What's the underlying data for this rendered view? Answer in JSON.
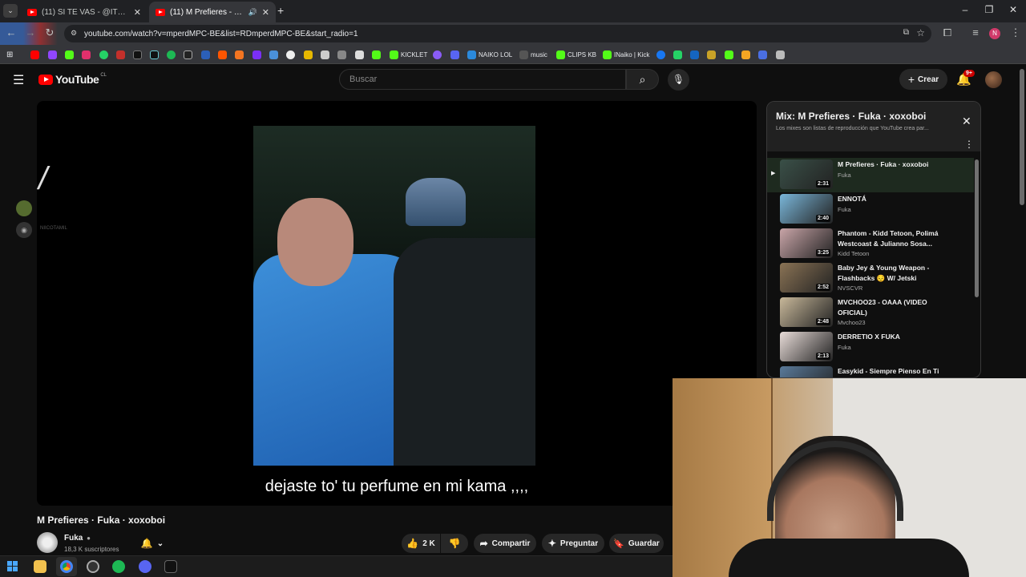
{
  "browser": {
    "tabs": [
      {
        "label": "(11) SI TE VAS - @ITHANNY | VI",
        "active": false
      },
      {
        "label": "(11) M Prefieres - Fuka - xox",
        "active": true
      }
    ],
    "url": "youtube.com/watch?v=mperdMPC-BE&list=RDmperdMPC-BE&start_radio=1",
    "bookmarks": [
      "KICKLET",
      "NAIKO LOL",
      "music",
      "CLIPS KB",
      "INaiko | Kick"
    ]
  },
  "youtube": {
    "logo": "YouTube",
    "region": "CL",
    "search_placeholder": "Buscar",
    "create_label": "Crear",
    "notifications": "9+",
    "avatar_letter": "N"
  },
  "video": {
    "subtitle": "dejaste to' tu perfume en mi kama ,,,,",
    "overlay_text": "NIICOTAMIL",
    "title": "M Prefieres · Fuka · xoxoboi",
    "channel": "Fuka",
    "subscribers": "18,3 K suscriptores",
    "likes": "2 K",
    "share_label": "Compartir",
    "ask_label": "Preguntar",
    "save_label": "Guardar"
  },
  "playlist": {
    "title": "Mix: M Prefieres · Fuka · xoxoboi",
    "description": "Los mixes son listas de reproducción que YouTube crea par...",
    "items": [
      {
        "title": "M Prefieres · Fuka · xoxoboi",
        "channel": "Fuka",
        "duration": "2:31",
        "color": "#3a5048",
        "active": true
      },
      {
        "title": "ENNOTÁ",
        "channel": "Fuka",
        "duration": "2:40",
        "color": "#7ab6d9",
        "active": false
      },
      {
        "title": "Phantom - Kidd Tetoon, Polimá Westcoast & Julianno Sosa...",
        "channel": "Kidd Tetoon",
        "duration": "3:25",
        "color": "#c9a5a8",
        "active": false
      },
      {
        "title": "Baby Jey & Young Weapon - Flashbacks 😔 W/ Jetski",
        "channel": "NVSCVR",
        "duration": "2:52",
        "color": "#8a7355",
        "active": false
      },
      {
        "title": "MVCHOO23 - OAAA (VIDEO OFICIAL)",
        "channel": "Mvchoo23",
        "duration": "2:48",
        "color": "#c8b89a",
        "active": false
      },
      {
        "title": "DERRETIO X FUKA",
        "channel": "Fuka",
        "duration": "2:13",
        "color": "#e8dcd8",
        "active": false
      },
      {
        "title": "Easykid - Siempre Pienso En Ti",
        "channel": "",
        "duration": "",
        "color": "#5a7a9a",
        "active": false
      }
    ]
  }
}
